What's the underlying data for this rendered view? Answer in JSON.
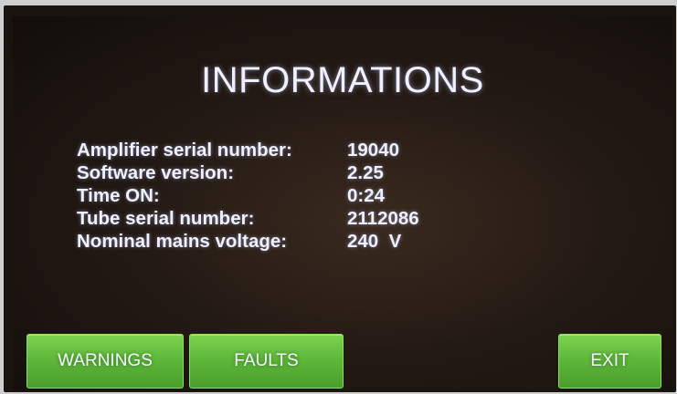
{
  "screen": {
    "title": "INFORMATIONS"
  },
  "info": {
    "rows": [
      {
        "label": "Amplifier serial number:",
        "value": "19040"
      },
      {
        "label": "Software version:",
        "value": "2.25"
      },
      {
        "label": "Time ON:",
        "value": "0:24"
      },
      {
        "label": "Tube serial number:",
        "value": "2112086"
      },
      {
        "label": "Nominal mains voltage:",
        "value": "240  V"
      }
    ]
  },
  "buttons": {
    "warnings": "WARNINGS",
    "faults": "FAULTS",
    "exit": "EXIT"
  },
  "colors": {
    "button_green": "#5fb83a",
    "text": "#eef0ff",
    "background": "#1a1410"
  }
}
